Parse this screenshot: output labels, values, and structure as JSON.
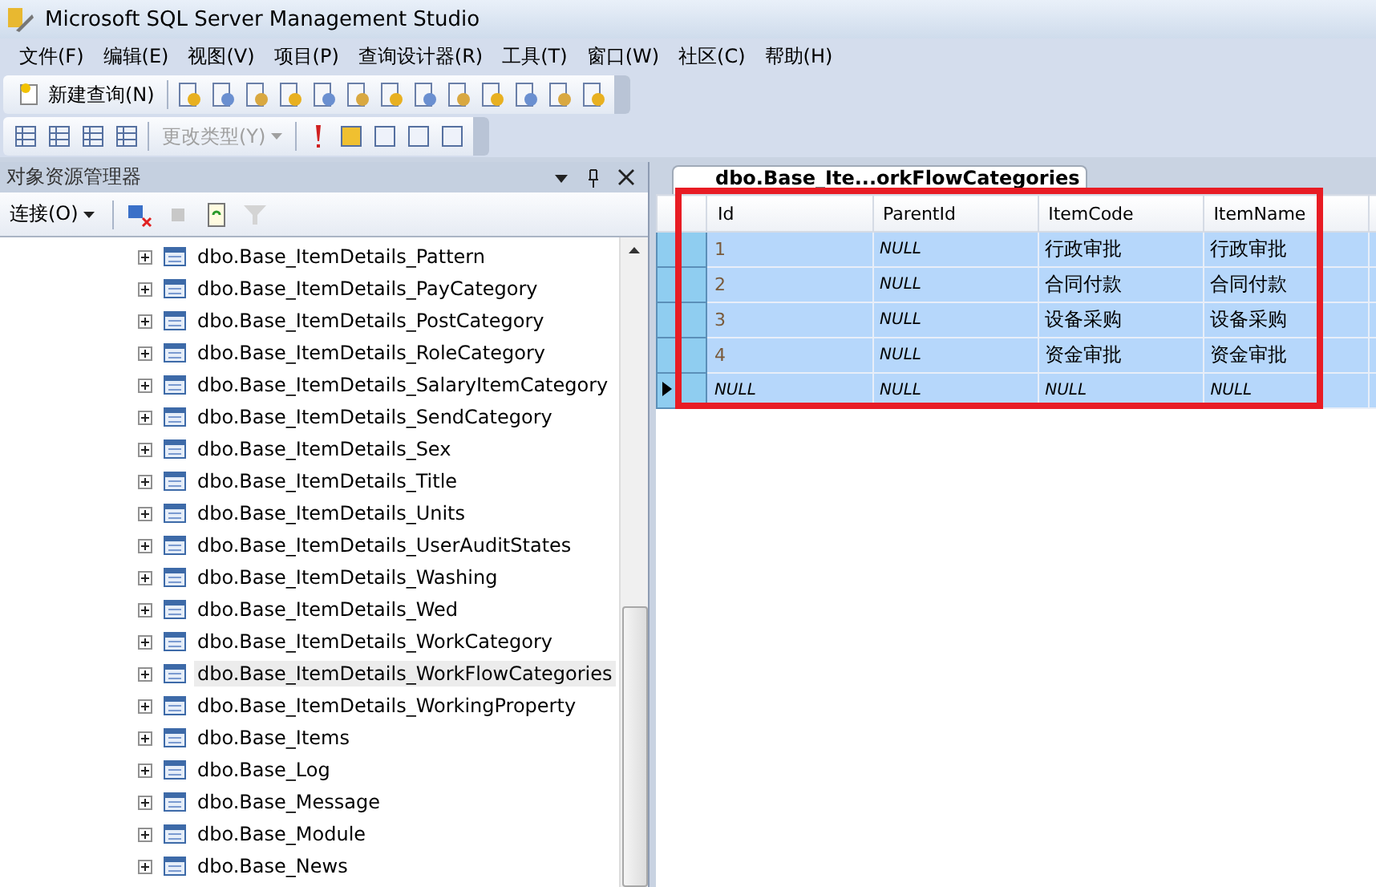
{
  "window": {
    "title": "Microsoft SQL Server Management Studio"
  },
  "menu": [
    "文件(F)",
    "编辑(E)",
    "视图(V)",
    "项目(P)",
    "查询设计器(R)",
    "工具(T)",
    "窗口(W)",
    "社区(C)",
    "帮助(H)"
  ],
  "toolbar": {
    "new_query": "新建查询(N)",
    "change_type": {
      "label": "更改类型(Y)",
      "disabled": true
    }
  },
  "object_explorer": {
    "title": "对象资源管理器",
    "connect": "连接(O)",
    "items": [
      {
        "label": "dbo.Base_ItemDetails_Pattern",
        "expanded": false,
        "selected": false
      },
      {
        "label": "dbo.Base_ItemDetails_PayCategory",
        "expanded": false,
        "selected": false
      },
      {
        "label": "dbo.Base_ItemDetails_PostCategory",
        "expanded": false,
        "selected": false
      },
      {
        "label": "dbo.Base_ItemDetails_RoleCategory",
        "expanded": false,
        "selected": false
      },
      {
        "label": "dbo.Base_ItemDetails_SalaryItemCategory",
        "expanded": false,
        "selected": false
      },
      {
        "label": "dbo.Base_ItemDetails_SendCategory",
        "expanded": false,
        "selected": false
      },
      {
        "label": "dbo.Base_ItemDetails_Sex",
        "expanded": false,
        "selected": false
      },
      {
        "label": "dbo.Base_ItemDetails_Title",
        "expanded": false,
        "selected": false
      },
      {
        "label": "dbo.Base_ItemDetails_Units",
        "expanded": false,
        "selected": false
      },
      {
        "label": "dbo.Base_ItemDetails_UserAuditStates",
        "expanded": false,
        "selected": false
      },
      {
        "label": "dbo.Base_ItemDetails_Washing",
        "expanded": false,
        "selected": false
      },
      {
        "label": "dbo.Base_ItemDetails_Wed",
        "expanded": false,
        "selected": false
      },
      {
        "label": "dbo.Base_ItemDetails_WorkCategory",
        "expanded": false,
        "selected": false
      },
      {
        "label": "dbo.Base_ItemDetails_WorkFlowCategories",
        "expanded": false,
        "selected": true
      },
      {
        "label": "dbo.Base_ItemDetails_WorkingProperty",
        "expanded": false,
        "selected": false
      },
      {
        "label": "dbo.Base_Items",
        "expanded": false,
        "selected": false
      },
      {
        "label": "dbo.Base_Log",
        "expanded": false,
        "selected": false
      },
      {
        "label": "dbo.Base_Message",
        "expanded": false,
        "selected": false
      },
      {
        "label": "dbo.Base_Module",
        "expanded": false,
        "selected": false
      },
      {
        "label": "dbo.Base_News",
        "expanded": false,
        "selected": false
      }
    ]
  },
  "document_tab": {
    "label": "dbo.Base_Ite...orkFlowCategories",
    "selected": true
  },
  "table": {
    "columns": [
      "Id",
      "ParentId",
      "ItemCode",
      "ItemName"
    ],
    "rows": [
      {
        "selected": true,
        "current": false,
        "cells": [
          {
            "text": "1",
            "kind": "value"
          },
          {
            "text": "NULL",
            "kind": "null"
          },
          {
            "text": "行政审批",
            "kind": "value"
          },
          {
            "text": "行政审批",
            "kind": "value"
          }
        ]
      },
      {
        "selected": true,
        "current": false,
        "cells": [
          {
            "text": "2",
            "kind": "value"
          },
          {
            "text": "NULL",
            "kind": "null"
          },
          {
            "text": "合同付款",
            "kind": "value"
          },
          {
            "text": "合同付款",
            "kind": "value"
          }
        ]
      },
      {
        "selected": true,
        "current": false,
        "cells": [
          {
            "text": "3",
            "kind": "value"
          },
          {
            "text": "NULL",
            "kind": "null"
          },
          {
            "text": "设备采购",
            "kind": "value"
          },
          {
            "text": "设备采购",
            "kind": "value"
          }
        ]
      },
      {
        "selected": true,
        "current": false,
        "cells": [
          {
            "text": "4",
            "kind": "value"
          },
          {
            "text": "NULL",
            "kind": "null"
          },
          {
            "text": "资金审批",
            "kind": "value"
          },
          {
            "text": "资金审批",
            "kind": "value"
          }
        ]
      },
      {
        "selected": true,
        "current": true,
        "cells": [
          {
            "text": "NULL",
            "kind": "null"
          },
          {
            "text": "NULL",
            "kind": "null"
          },
          {
            "text": "NULL",
            "kind": "null"
          },
          {
            "text": "NULL",
            "kind": "null"
          }
        ]
      }
    ]
  }
}
